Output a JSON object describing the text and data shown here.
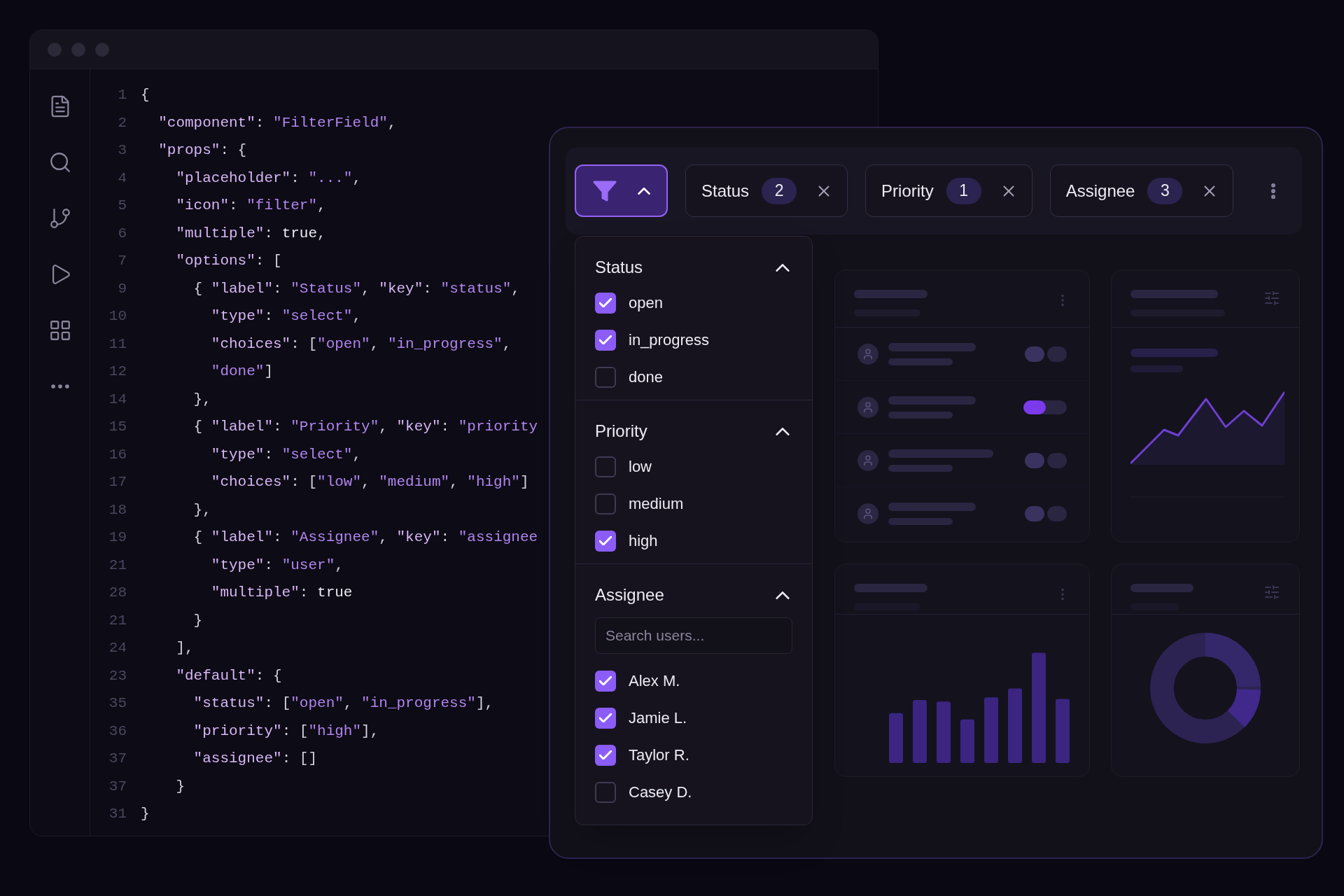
{
  "editor": {
    "lines": [
      {
        "number": "1",
        "segments": [
          {
            "kind": "punct",
            "text": "{"
          }
        ]
      },
      {
        "number": "2",
        "segments": [
          {
            "kind": "key",
            "text": "  \"component\""
          },
          {
            "kind": "punct",
            "text": ": "
          },
          {
            "kind": "string",
            "text": "\"FilterField\""
          },
          {
            "kind": "punct",
            "text": ","
          }
        ]
      },
      {
        "number": "3",
        "segments": [
          {
            "kind": "key",
            "text": "  \"props\""
          },
          {
            "kind": "punct",
            "text": ": {"
          }
        ]
      },
      {
        "number": "4",
        "segments": [
          {
            "kind": "key",
            "text": "    \"placeholder\""
          },
          {
            "kind": "punct",
            "text": ": "
          },
          {
            "kind": "string",
            "text": "\"...\""
          },
          {
            "kind": "punct",
            "text": ","
          }
        ]
      },
      {
        "number": "5",
        "segments": [
          {
            "kind": "key",
            "text": "    \"icon\""
          },
          {
            "kind": "punct",
            "text": ": "
          },
          {
            "kind": "string",
            "text": "\"filter\""
          },
          {
            "kind": "punct",
            "text": ","
          }
        ]
      },
      {
        "number": "6",
        "segments": [
          {
            "kind": "key",
            "text": "    \"multiple\""
          },
          {
            "kind": "punct",
            "text": ": "
          },
          {
            "kind": "literal",
            "text": "true"
          },
          {
            "kind": "punct",
            "text": ","
          }
        ]
      },
      {
        "number": "7",
        "segments": [
          {
            "kind": "key",
            "text": "    \"options\""
          },
          {
            "kind": "punct",
            "text": ": ["
          }
        ]
      },
      {
        "number": "9",
        "segments": [
          {
            "kind": "punct",
            "text": "      { "
          },
          {
            "kind": "key",
            "text": "\"label\""
          },
          {
            "kind": "punct",
            "text": ": "
          },
          {
            "kind": "string",
            "text": "\"Status\""
          },
          {
            "kind": "punct",
            "text": ", "
          },
          {
            "kind": "key",
            "text": "\"key\""
          },
          {
            "kind": "punct",
            "text": ": "
          },
          {
            "kind": "string",
            "text": "\"status\""
          },
          {
            "kind": "punct",
            "text": ","
          }
        ]
      },
      {
        "number": "10",
        "segments": [
          {
            "kind": "key",
            "text": "        \"type\""
          },
          {
            "kind": "punct",
            "text": ": "
          },
          {
            "kind": "string",
            "text": "\"select\""
          },
          {
            "kind": "punct",
            "text": ","
          }
        ]
      },
      {
        "number": "11",
        "segments": [
          {
            "kind": "key",
            "text": "        \"choices\""
          },
          {
            "kind": "punct",
            "text": ": ["
          },
          {
            "kind": "string",
            "text": "\"open\""
          },
          {
            "kind": "punct",
            "text": ", "
          },
          {
            "kind": "string",
            "text": "\"in_progress\""
          },
          {
            "kind": "punct",
            "text": ","
          }
        ]
      },
      {
        "number": "12",
        "segments": [
          {
            "kind": "string",
            "text": "        \"done\""
          },
          {
            "kind": "punct",
            "text": "]"
          }
        ]
      },
      {
        "number": "14",
        "segments": [
          {
            "kind": "punct",
            "text": "      },"
          }
        ]
      },
      {
        "number": "15",
        "segments": [
          {
            "kind": "punct",
            "text": "      { "
          },
          {
            "kind": "key",
            "text": "\"label\""
          },
          {
            "kind": "punct",
            "text": ": "
          },
          {
            "kind": "string",
            "text": "\"Priority\""
          },
          {
            "kind": "punct",
            "text": ", "
          },
          {
            "kind": "key",
            "text": "\"key\""
          },
          {
            "kind": "punct",
            "text": ": "
          },
          {
            "kind": "string",
            "text": "\"priority"
          }
        ]
      },
      {
        "number": "16",
        "segments": [
          {
            "kind": "key",
            "text": "        \"type\""
          },
          {
            "kind": "punct",
            "text": ": "
          },
          {
            "kind": "string",
            "text": "\"select\""
          },
          {
            "kind": "punct",
            "text": ","
          }
        ]
      },
      {
        "number": "17",
        "segments": [
          {
            "kind": "key",
            "text": "        \"choices\""
          },
          {
            "kind": "punct",
            "text": ": ["
          },
          {
            "kind": "string",
            "text": "\"low\""
          },
          {
            "kind": "punct",
            "text": ", "
          },
          {
            "kind": "string",
            "text": "\"medium\""
          },
          {
            "kind": "punct",
            "text": ", "
          },
          {
            "kind": "string",
            "text": "\"high\""
          },
          {
            "kind": "punct",
            "text": "]"
          }
        ]
      },
      {
        "number": "18",
        "segments": [
          {
            "kind": "punct",
            "text": "      },"
          }
        ]
      },
      {
        "number": "19",
        "segments": [
          {
            "kind": "punct",
            "text": "      { "
          },
          {
            "kind": "key",
            "text": "\"label\""
          },
          {
            "kind": "punct",
            "text": ": "
          },
          {
            "kind": "string",
            "text": "\"Assignee\""
          },
          {
            "kind": "punct",
            "text": ", "
          },
          {
            "kind": "key",
            "text": "\"key\""
          },
          {
            "kind": "punct",
            "text": ": "
          },
          {
            "kind": "string",
            "text": "\"assignee"
          }
        ]
      },
      {
        "number": "21",
        "segments": [
          {
            "kind": "key",
            "text": "        \"type\""
          },
          {
            "kind": "punct",
            "text": ": "
          },
          {
            "kind": "string",
            "text": "\"user\""
          },
          {
            "kind": "punct",
            "text": ","
          }
        ]
      },
      {
        "number": "28",
        "segments": [
          {
            "kind": "key",
            "text": "        \"multiple\""
          },
          {
            "kind": "punct",
            "text": ": "
          },
          {
            "kind": "literal",
            "text": "true"
          }
        ]
      },
      {
        "number": "21",
        "segments": [
          {
            "kind": "punct",
            "text": "      }"
          }
        ]
      },
      {
        "number": "24",
        "segments": [
          {
            "kind": "punct",
            "text": "    ],"
          }
        ]
      },
      {
        "number": "23",
        "segments": [
          {
            "kind": "key",
            "text": "    \"default\""
          },
          {
            "kind": "punct",
            "text": ": {"
          }
        ]
      },
      {
        "number": "35",
        "segments": [
          {
            "kind": "key",
            "text": "      \"status\""
          },
          {
            "kind": "punct",
            "text": ": ["
          },
          {
            "kind": "string",
            "text": "\"open\""
          },
          {
            "kind": "punct",
            "text": ", "
          },
          {
            "kind": "string",
            "text": "\"in_progress\""
          },
          {
            "kind": "punct",
            "text": "],"
          }
        ]
      },
      {
        "number": "36",
        "segments": [
          {
            "kind": "key",
            "text": "      \"priority\""
          },
          {
            "kind": "punct",
            "text": ": ["
          },
          {
            "kind": "string",
            "text": "\"high\""
          },
          {
            "kind": "punct",
            "text": "],"
          }
        ]
      },
      {
        "number": "37",
        "segments": [
          {
            "kind": "key",
            "text": "      \"assignee\""
          },
          {
            "kind": "punct",
            "text": ": []"
          }
        ]
      },
      {
        "number": "37",
        "segments": [
          {
            "kind": "punct",
            "text": "    }"
          }
        ]
      },
      {
        "number": "31",
        "segments": [
          {
            "kind": "punct",
            "text": "}"
          }
        ]
      }
    ]
  },
  "filter_panel": {
    "filter_button": {
      "expanded": true
    },
    "filters": [
      {
        "label": "Status",
        "count": "2"
      },
      {
        "label": "Priority",
        "count": "1"
      },
      {
        "label": "Assignee",
        "count": "3"
      }
    ],
    "dropdown": [
      {
        "title": "Status",
        "expanded": true,
        "options": [
          {
            "label": "open",
            "checked": true
          },
          {
            "label": "in_progress",
            "checked": true
          },
          {
            "label": "done",
            "checked": false
          }
        ]
      },
      {
        "title": "Priority",
        "expanded": true,
        "options": [
          {
            "label": "low",
            "checked": false
          },
          {
            "label": "medium",
            "checked": false
          },
          {
            "label": "high",
            "checked": true
          }
        ]
      },
      {
        "title": "Assignee",
        "expanded": true,
        "search": {
          "placeholder": "Search users..."
        },
        "options": [
          {
            "label": "Alex M.",
            "checked": true
          },
          {
            "label": "Jamie L.",
            "checked": true
          },
          {
            "label": "Taylor R.",
            "checked": true
          },
          {
            "label": "Casey D.",
            "checked": false
          }
        ]
      }
    ]
  }
}
